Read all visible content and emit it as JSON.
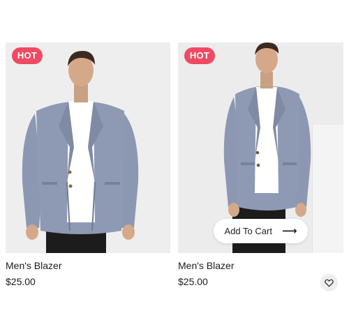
{
  "products": [
    {
      "badge": "HOT",
      "title": "Men's Blazer",
      "price": "$25.00",
      "image_icon": "man-in-blazer-photo"
    },
    {
      "badge": "HOT",
      "title": "Men's Blazer",
      "price": "$25.00",
      "image_icon": "man-in-blazer-photo",
      "add_to_cart_label": "Add To Cart",
      "add_to_cart_icon": "arrow-right-icon",
      "wishlist_icon": "heart-icon"
    }
  ],
  "colors": {
    "badge": "#ef4a62",
    "image_bg": "#eeeeee",
    "blazer": "#8c98b2",
    "shirt": "#ffffff",
    "pants": "#1c1c1c",
    "skin": "#d6a88a",
    "hair": "#3b2a20",
    "text": "#1b1b1b"
  }
}
